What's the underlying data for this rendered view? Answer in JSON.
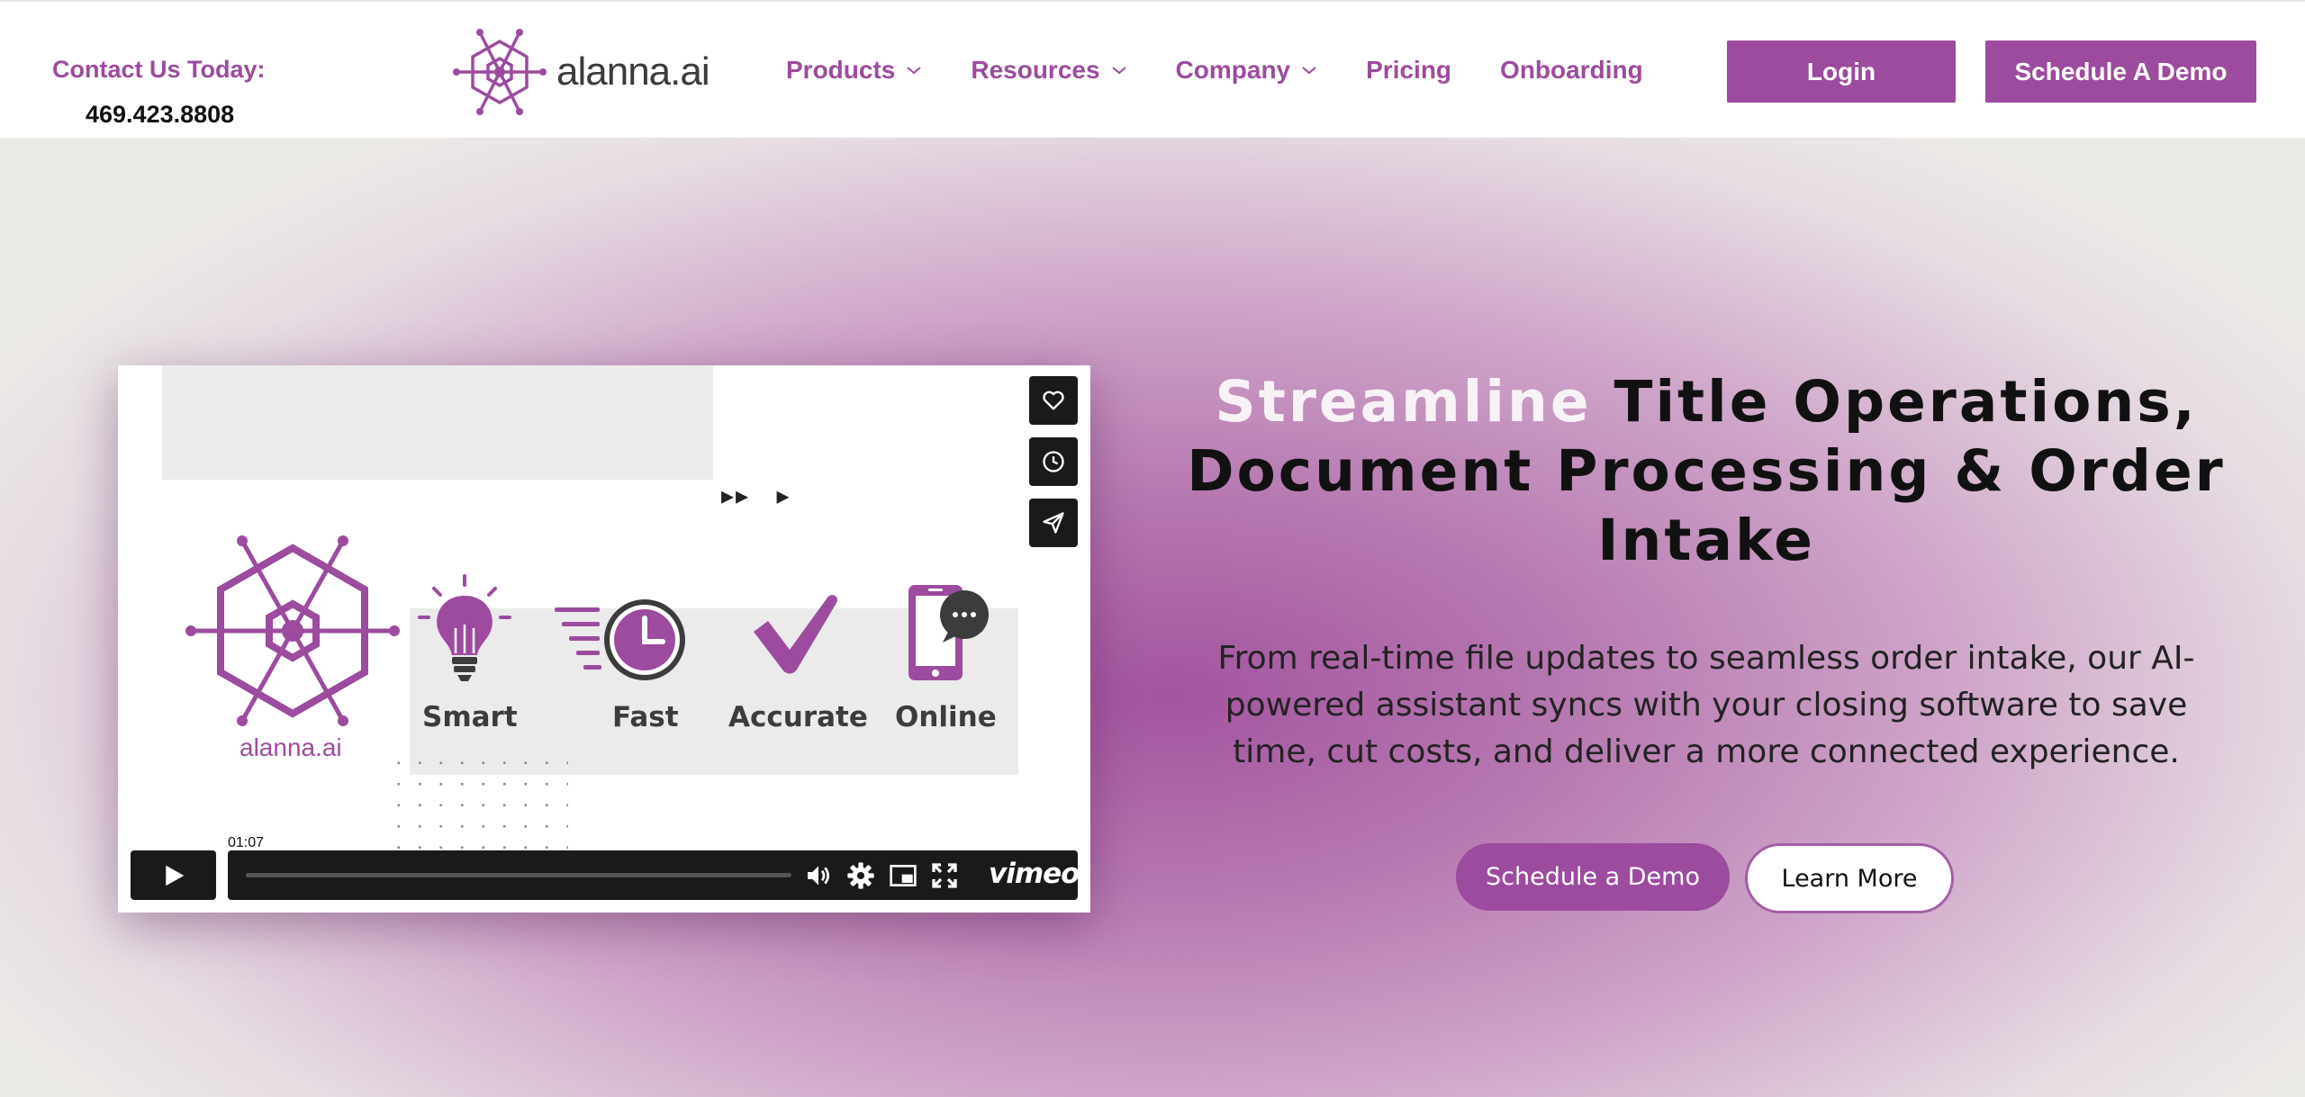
{
  "header": {
    "contact_label": "Contact Us Today:",
    "phone": "469.423.8808",
    "logo_text": "alanna.ai",
    "nav": [
      {
        "label": "Products",
        "has_dropdown": true
      },
      {
        "label": "Resources",
        "has_dropdown": true
      },
      {
        "label": "Company",
        "has_dropdown": true
      },
      {
        "label": "Pricing",
        "has_dropdown": false
      },
      {
        "label": "Onboarding",
        "has_dropdown": false
      }
    ],
    "login_label": "Login",
    "schedule_label": "Schedule A Demo"
  },
  "video": {
    "brand_text": "alanna.ai",
    "features": [
      "Smart",
      "Fast",
      "Accurate",
      "Online"
    ],
    "time": "01:07",
    "player_brand": "vimeo",
    "side_icons": [
      "heart-icon",
      "clock-icon",
      "send-icon"
    ],
    "controls": [
      "play-icon",
      "volume-icon",
      "settings-icon",
      "pip-icon",
      "fullscreen-icon"
    ]
  },
  "hero": {
    "headline_accent": "Streamline",
    "headline_rest": " Title Operations, Document Processing & Order Intake",
    "subtext": "From real-time file updates to seamless order intake, our AI-powered assistant syncs with your closing software to save time, cut costs, and deliver a more connected experience.",
    "demo_button": "Schedule a Demo",
    "learn_button": "Learn More"
  },
  "colors": {
    "brand_purple": "#9c4b9e",
    "headline_accent": "#f7f2f6",
    "player_dark": "#1a1a1a"
  }
}
